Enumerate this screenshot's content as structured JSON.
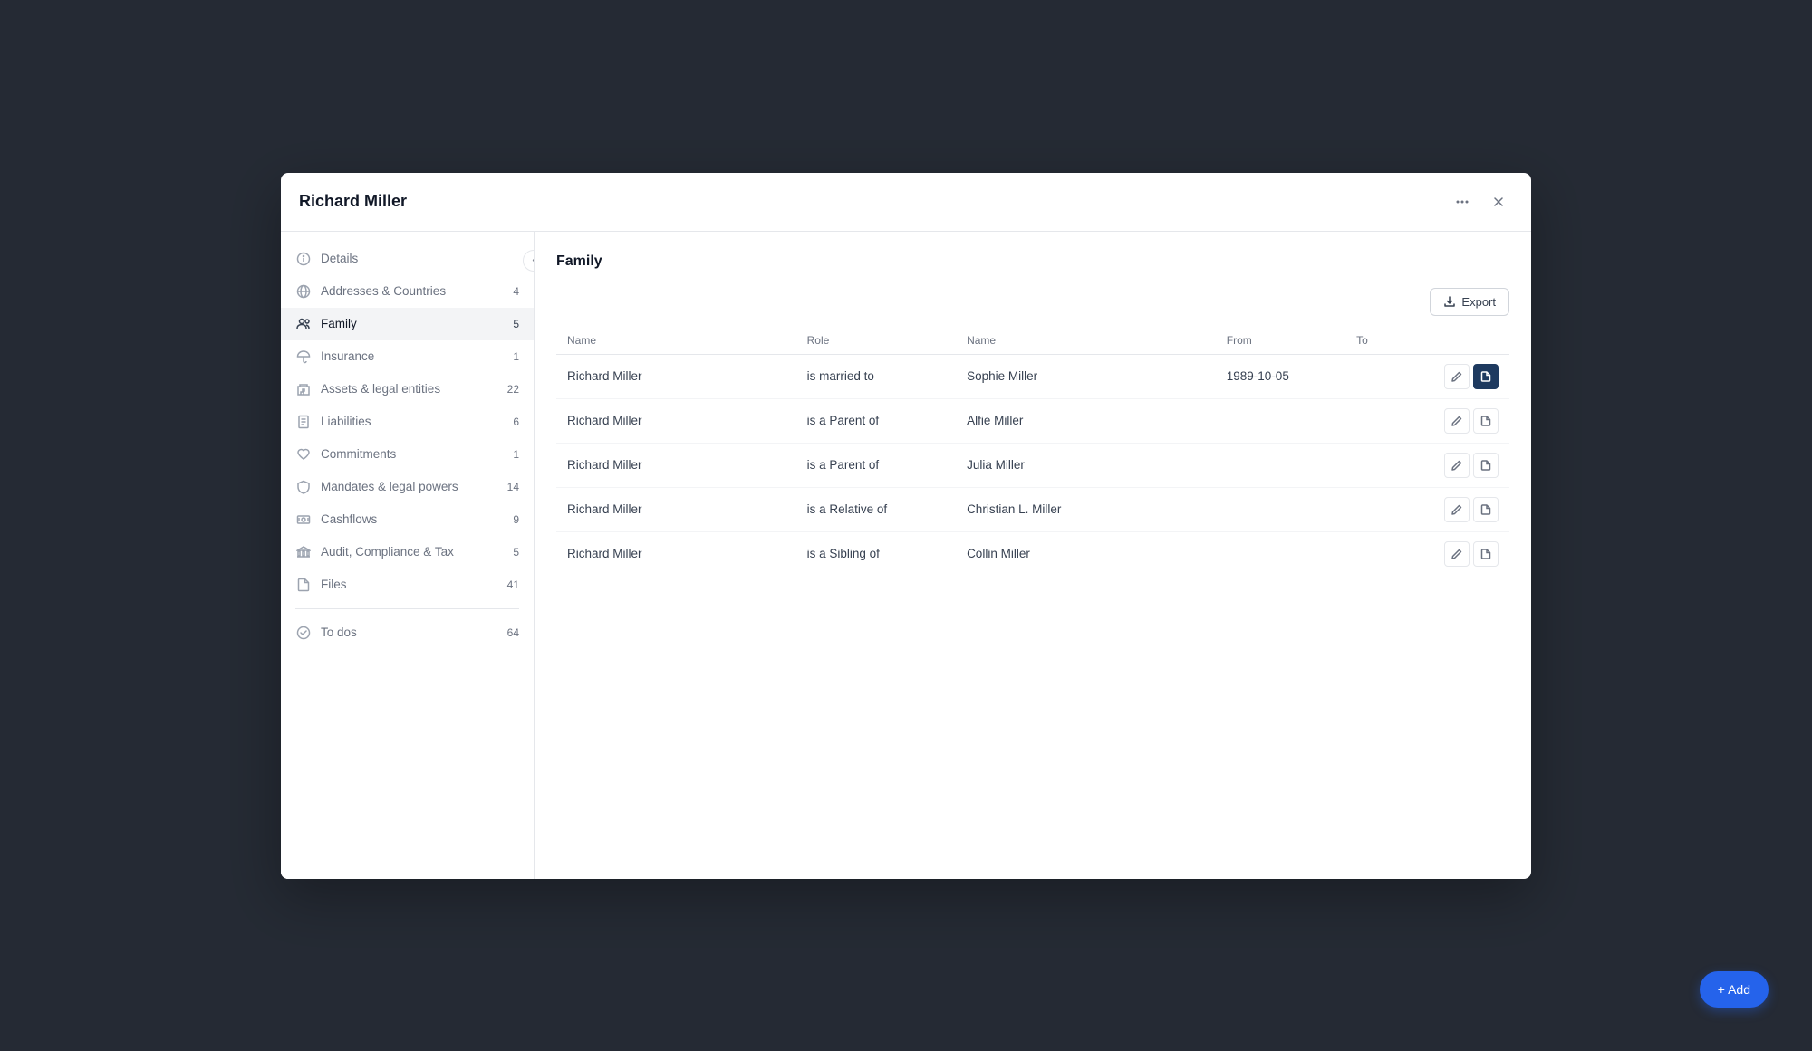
{
  "modal": {
    "title": "Richard Miller"
  },
  "sidebar": {
    "collapse_label": "‹",
    "items": [
      {
        "id": "details",
        "label": "Details",
        "count": null,
        "icon": "info"
      },
      {
        "id": "addresses",
        "label": "Addresses & Countries",
        "count": "4",
        "icon": "globe"
      },
      {
        "id": "family",
        "label": "Family",
        "count": "5",
        "icon": "users",
        "active": true
      },
      {
        "id": "insurance",
        "label": "Insurance",
        "count": "1",
        "icon": "umbrella"
      },
      {
        "id": "assets",
        "label": "Assets & legal entities",
        "count": "22",
        "icon": "building"
      },
      {
        "id": "liabilities",
        "label": "Liabilities",
        "count": "6",
        "icon": "receipt"
      },
      {
        "id": "commitments",
        "label": "Commitments",
        "count": "1",
        "icon": "heart"
      },
      {
        "id": "mandates",
        "label": "Mandates & legal powers",
        "count": "14",
        "icon": "shield"
      },
      {
        "id": "cashflows",
        "label": "Cashflows",
        "count": "9",
        "icon": "cash"
      },
      {
        "id": "audit",
        "label": "Audit, Compliance & Tax",
        "count": "5",
        "icon": "bank"
      },
      {
        "id": "files",
        "label": "Files",
        "count": "41",
        "icon": "file"
      }
    ],
    "divider_after": "files",
    "bottom_items": [
      {
        "id": "todos",
        "label": "To dos",
        "count": "64",
        "icon": "check-circle"
      }
    ]
  },
  "content": {
    "section_title": "Family",
    "export_label": "Export",
    "table": {
      "columns": [
        {
          "key": "name",
          "label": "Name"
        },
        {
          "key": "role",
          "label": "Role"
        },
        {
          "key": "related_name",
          "label": "Name"
        },
        {
          "key": "from",
          "label": "From"
        },
        {
          "key": "to",
          "label": "To"
        }
      ],
      "rows": [
        {
          "name": "Richard Miller",
          "role": "is married to",
          "related_name": "Sophie Miller",
          "from": "1989-10-05",
          "to": "",
          "doc_active": true
        },
        {
          "name": "Richard Miller",
          "role": "is a Parent of",
          "related_name": "Alfie Miller",
          "from": "",
          "to": "",
          "doc_active": false
        },
        {
          "name": "Richard Miller",
          "role": "is a Parent of",
          "related_name": "Julia Miller",
          "from": "",
          "to": "",
          "doc_active": false
        },
        {
          "name": "Richard Miller",
          "role": "is a Relative of",
          "related_name": "Christian L. Miller",
          "from": "",
          "to": "",
          "doc_active": false
        },
        {
          "name": "Richard Miller",
          "role": "is a Sibling of",
          "related_name": "Collin Miller",
          "from": "",
          "to": "",
          "doc_active": false
        }
      ]
    }
  },
  "add_button": {
    "label": "+ Add"
  }
}
